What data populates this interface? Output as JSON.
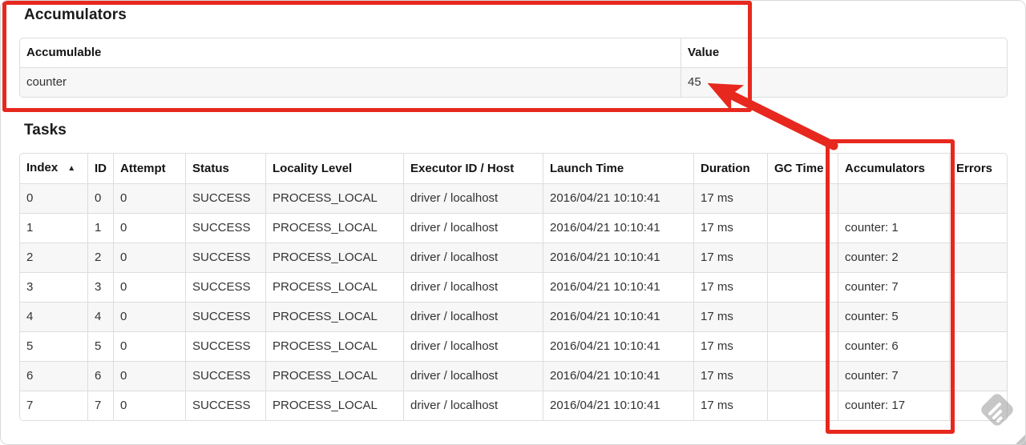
{
  "accumulators": {
    "title": "Accumulators",
    "table": {
      "headers": [
        "Accumulable",
        "Value"
      ],
      "rows": [
        [
          "counter",
          "45"
        ]
      ]
    }
  },
  "tasks": {
    "title": "Tasks",
    "table": {
      "headers": [
        "Index",
        "ID",
        "Attempt",
        "Status",
        "Locality Level",
        "Executor ID / Host",
        "Launch Time",
        "Duration",
        "GC Time",
        "Accumulators",
        "Errors"
      ],
      "sort_column": 0,
      "sort_icon": "▲",
      "rows": [
        [
          "0",
          "0",
          "0",
          "SUCCESS",
          "PROCESS_LOCAL",
          "driver / localhost",
          "2016/04/21 10:10:41",
          "17 ms",
          "",
          "",
          ""
        ],
        [
          "1",
          "1",
          "0",
          "SUCCESS",
          "PROCESS_LOCAL",
          "driver / localhost",
          "2016/04/21 10:10:41",
          "17 ms",
          "",
          "counter: 1",
          ""
        ],
        [
          "2",
          "2",
          "0",
          "SUCCESS",
          "PROCESS_LOCAL",
          "driver / localhost",
          "2016/04/21 10:10:41",
          "17 ms",
          "",
          "counter: 2",
          ""
        ],
        [
          "3",
          "3",
          "0",
          "SUCCESS",
          "PROCESS_LOCAL",
          "driver / localhost",
          "2016/04/21 10:10:41",
          "17 ms",
          "",
          "counter: 7",
          ""
        ],
        [
          "4",
          "4",
          "0",
          "SUCCESS",
          "PROCESS_LOCAL",
          "driver / localhost",
          "2016/04/21 10:10:41",
          "17 ms",
          "",
          "counter: 5",
          ""
        ],
        [
          "5",
          "5",
          "0",
          "SUCCESS",
          "PROCESS_LOCAL",
          "driver / localhost",
          "2016/04/21 10:10:41",
          "17 ms",
          "",
          "counter: 6",
          ""
        ],
        [
          "6",
          "6",
          "0",
          "SUCCESS",
          "PROCESS_LOCAL",
          "driver / localhost",
          "2016/04/21 10:10:41",
          "17 ms",
          "",
          "counter: 7",
          ""
        ],
        [
          "7",
          "7",
          "0",
          "SUCCESS",
          "PROCESS_LOCAL",
          "driver / localhost",
          "2016/04/21 10:10:41",
          "17 ms",
          "",
          "counter: 17",
          ""
        ]
      ]
    }
  },
  "annotations": {
    "color": "#e7281e",
    "highlights": [
      "accumulators-summary-box",
      "tasks-accumulators-column-box"
    ],
    "arrow_points_to": "45"
  },
  "watermark_icon": "pencil-diamond-watermark"
}
